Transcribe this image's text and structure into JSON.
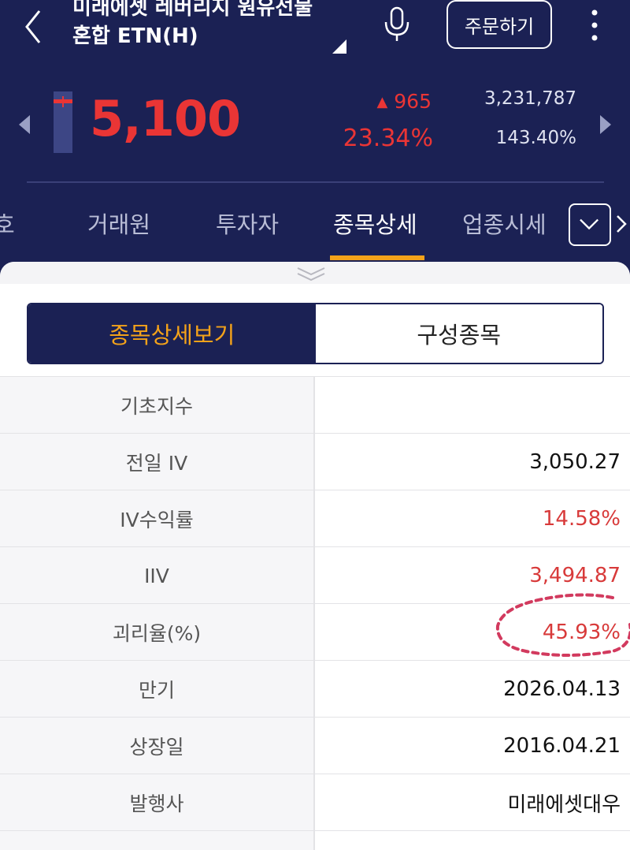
{
  "header": {
    "title": "미래에셋 레버리지 원유선물혼합 ETN(H)",
    "order_label": "주문하기",
    "icons": [
      "back-chevron-icon",
      "caret-icon",
      "microphone-icon",
      "more-vertical-icon"
    ]
  },
  "quote": {
    "price": "5,100",
    "change_amount": "965",
    "change_direction": "up",
    "change_percent": "23.34%",
    "volume": "3,231,787",
    "volume_rate": "143.40%",
    "up_color": "#ea3535"
  },
  "tabs": {
    "partial_left": "호",
    "items": [
      "거래원",
      "투자자",
      "종목상세",
      "업종시세"
    ],
    "active": "종목상세",
    "accent": "#f3a21a"
  },
  "segment": {
    "left_label": "종목상세보기",
    "right_label": "구성종목",
    "selected": "종목상세보기"
  },
  "details": {
    "rows": [
      {
        "label": "기초지수",
        "value": ""
      },
      {
        "label": "전일 IV",
        "value": "3,050.27"
      },
      {
        "label": "IV수익률",
        "value": "14.58%"
      },
      {
        "label": "IIV",
        "value": "3,494.87"
      },
      {
        "label": "괴리율(%)",
        "value": "45.93%"
      },
      {
        "label": "만기",
        "value": "2026.04.13"
      },
      {
        "label": "상장일",
        "value": "2016.04.21"
      },
      {
        "label": "발행사",
        "value": "미래에셋대우"
      }
    ]
  }
}
